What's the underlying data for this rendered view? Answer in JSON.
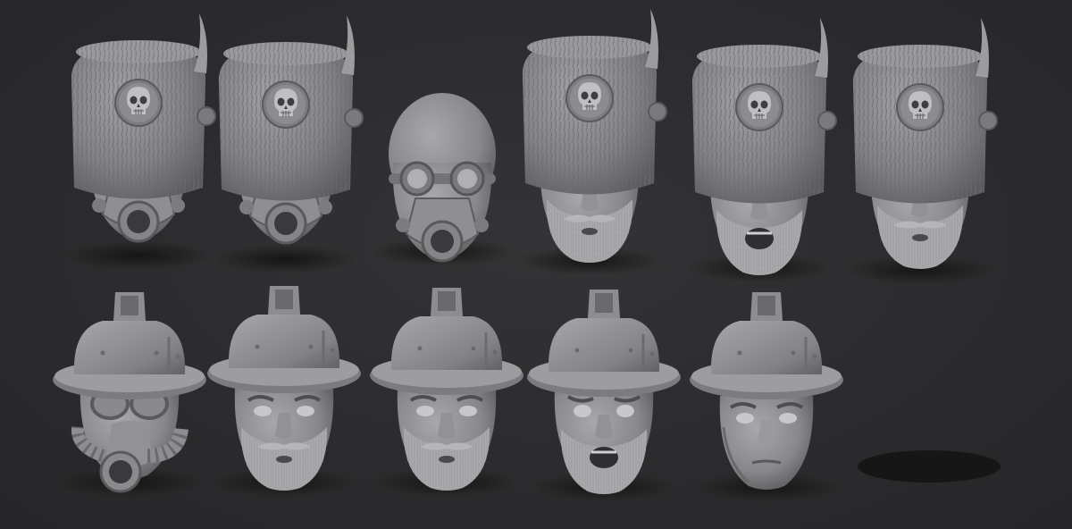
{
  "scene": {
    "background_color": "#2b2b2d",
    "material_color": "#8f8f92",
    "rows": [
      {
        "name": "fur-hat-row",
        "heads": [
          {
            "id": "fur-hat-skull-gasmask-head",
            "headgear": "fur-hat-skull",
            "face": "gas-mask"
          },
          {
            "id": "fur-hat-skull-gasmask-head",
            "headgear": "fur-hat-skull",
            "face": "gas-mask"
          },
          {
            "id": "bald-gasmask-goggles-head",
            "headgear": "none",
            "face": "gas-mask-goggles"
          },
          {
            "id": "fur-hat-skull-mustache-head",
            "headgear": "fur-hat-skull",
            "face": "mustache-beard"
          },
          {
            "id": "fur-hat-skull-shouting-bearded-head",
            "headgear": "fur-hat-skull",
            "face": "shouting-beard"
          },
          {
            "id": "fur-hat-skull-bearded-head",
            "headgear": "fur-hat-skull",
            "face": "stern-beard"
          }
        ]
      },
      {
        "name": "helmet-row",
        "heads": [
          {
            "id": "helmet-gasmask-head",
            "headgear": "brimmed-helmet",
            "face": "gas-mask-hose"
          },
          {
            "id": "helmet-bearded-head",
            "headgear": "brimmed-helmet",
            "face": "stern-beard"
          },
          {
            "id": "helmet-mustache-head",
            "headgear": "brimmed-helmet",
            "face": "mustache-beard"
          },
          {
            "id": "helmet-shouting-head",
            "headgear": "brimmed-helmet",
            "face": "shouting-beard"
          },
          {
            "id": "helmet-cleanshaven-head",
            "headgear": "brimmed-helmet",
            "face": "clean-shaven"
          }
        ]
      }
    ]
  }
}
